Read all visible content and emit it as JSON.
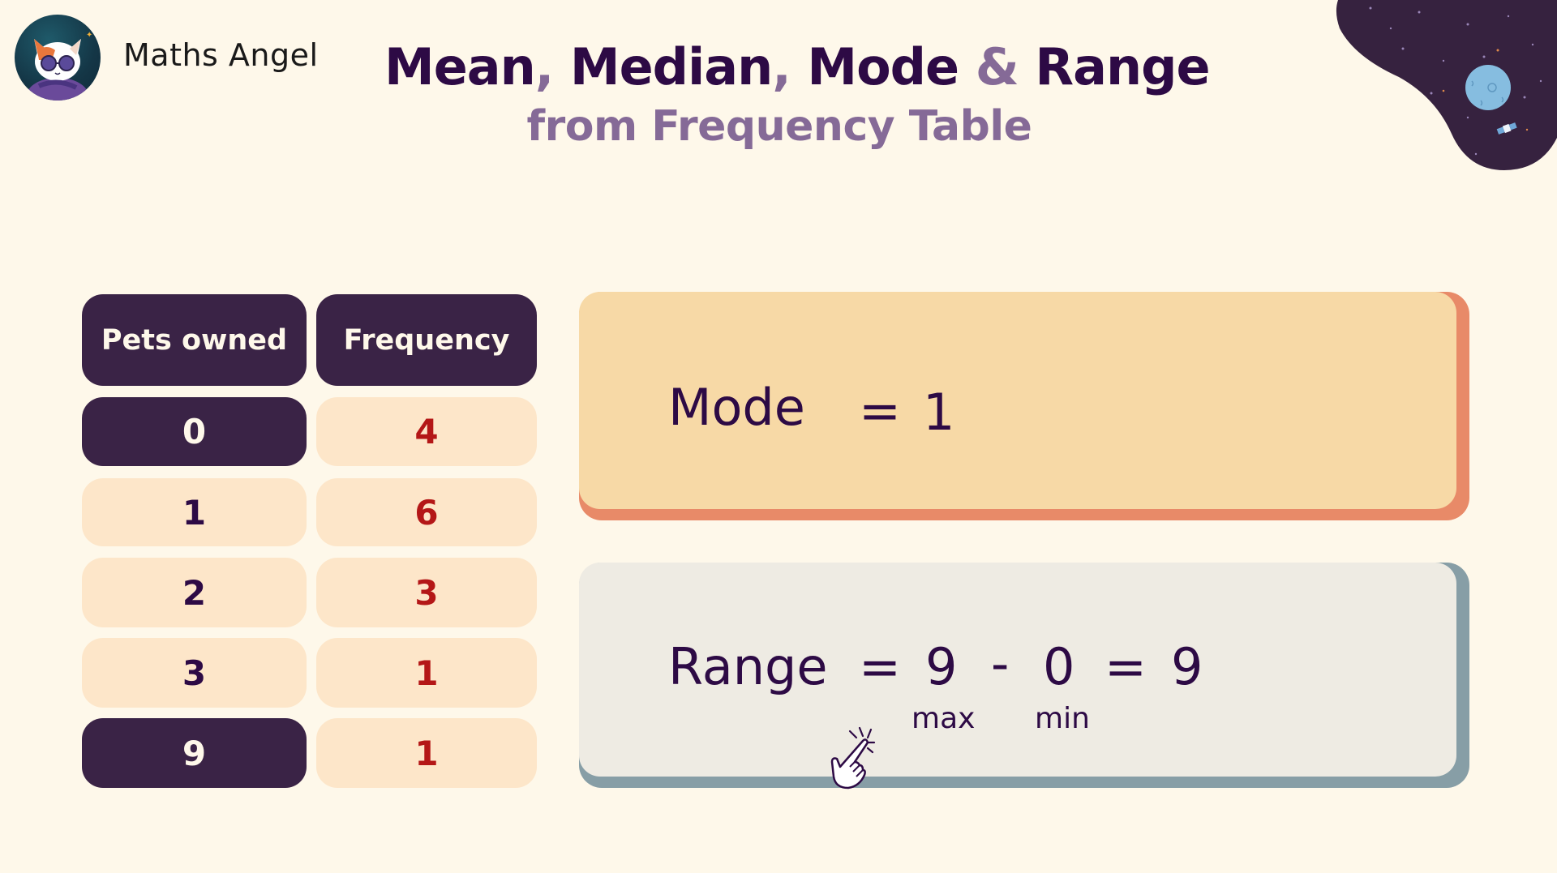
{
  "brand": {
    "name": "Maths Angel",
    "logo_icon": "cat-with-sunglasses-logo"
  },
  "header": {
    "title_parts": [
      "Mean",
      ", ",
      "Median",
      ", ",
      "Mode",
      " & ",
      "Range"
    ],
    "subtitle": "from Frequency Table"
  },
  "decoration": {
    "icon": "space-planet-satellite-blob"
  },
  "table": {
    "headers": [
      "Pets owned",
      "Frequency"
    ],
    "rows": [
      {
        "pets": "0",
        "frequency": "4",
        "highlighted": true
      },
      {
        "pets": "1",
        "frequency": "6",
        "highlighted": false
      },
      {
        "pets": "2",
        "frequency": "3",
        "highlighted": false
      },
      {
        "pets": "3",
        "frequency": "1",
        "highlighted": false
      },
      {
        "pets": "9",
        "frequency": "1",
        "highlighted": true
      }
    ]
  },
  "mode_card": {
    "label": "Mode",
    "equals": "=",
    "value": "1"
  },
  "range_card": {
    "label": "Range",
    "equals": "=",
    "max_value": "9",
    "minus": "-",
    "min_value": "0",
    "equals2": "=",
    "result": "9",
    "max_label": "max",
    "min_label": "min",
    "pointer_icon": "tapping-hand-icon"
  },
  "colors": {
    "background": "#fef8ea",
    "title": "#2d0a45",
    "accent": "#856a97",
    "dark_cell": "#3a2346",
    "light_cell": "#fde6c9",
    "frequency_text": "#b41717",
    "mode_card": "#f7d9a6",
    "mode_shadow": "#e88a68",
    "range_card": "#eeebe3",
    "range_shadow": "#879ea6"
  }
}
